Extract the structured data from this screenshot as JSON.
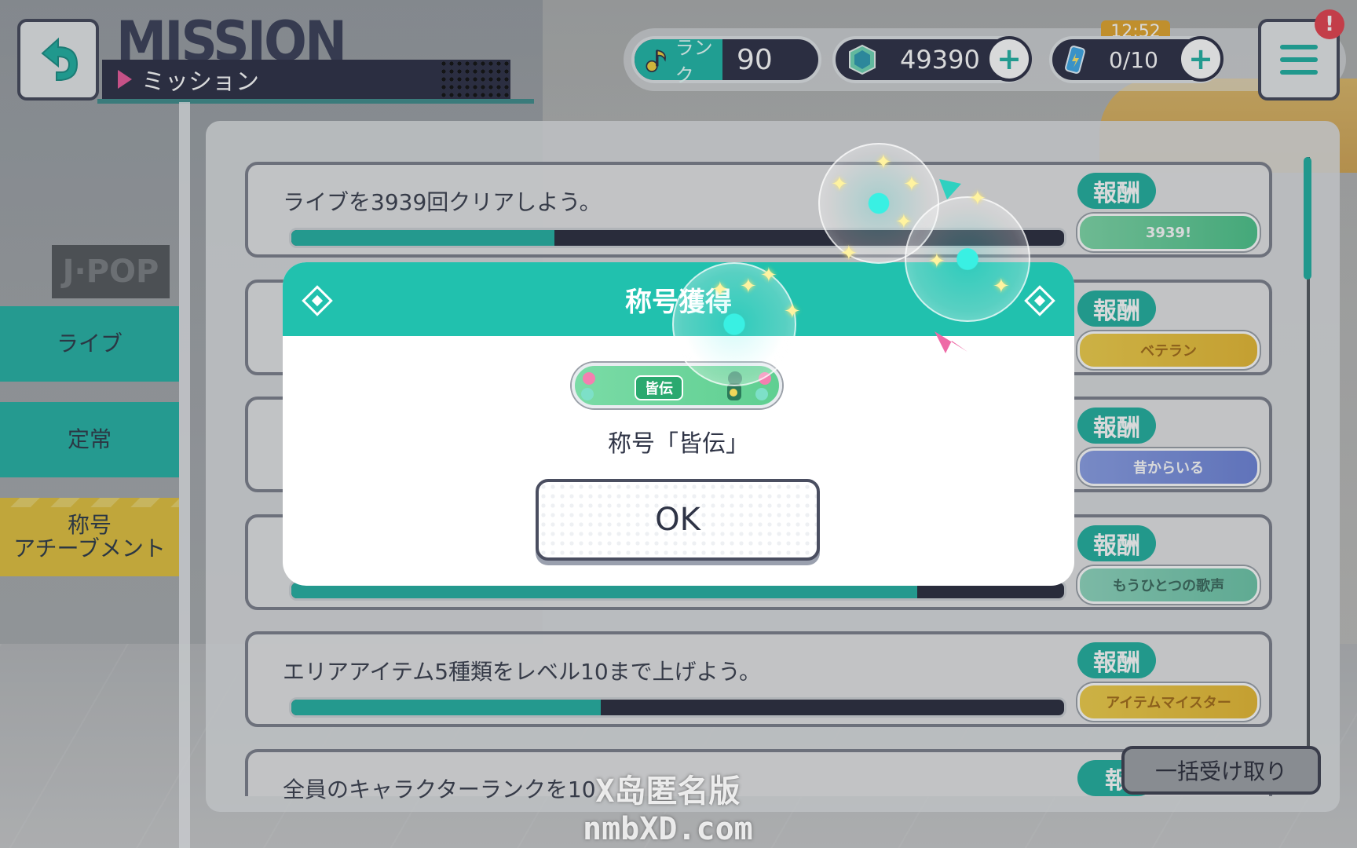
{
  "header": {
    "title": "MISSION",
    "subtitle": "ミッション",
    "rank_label": "ランク",
    "rank_value": "90",
    "gems": "49390",
    "stamina": "0/10",
    "timer": "12:52",
    "notification": "!"
  },
  "sidebar": {
    "tabs": [
      {
        "label": "ライブ"
      },
      {
        "label": "定常"
      },
      {
        "label_line1": "称号",
        "label_line2": "アチーブメント"
      }
    ]
  },
  "missions": [
    {
      "text": "ライブを3939回クリアしよう。",
      "progress": 0.34,
      "reward_label": "報酬",
      "reward_plate": "3939!"
    },
    {
      "text": "",
      "progress": 0.0,
      "reward_label": "報酬",
      "reward_plate": "ベテラン"
    },
    {
      "text": "",
      "progress": 0.0,
      "reward_label": "報酬",
      "reward_plate": "昔からいる"
    },
    {
      "text": "",
      "progress": 0.81,
      "reward_label": "報酬",
      "reward_plate": "もうひとつの歌声"
    },
    {
      "text": "エリアアイテム5種類をレベル10まで上げよう。",
      "progress": 0.4,
      "reward_label": "報酬",
      "reward_plate": "アイテムマイスター"
    },
    {
      "text": "全員のキャラクターランクを10",
      "progress": 0.0,
      "reward_label": "報",
      "reward_plate": ""
    }
  ],
  "bulk_button": "一括受け取り",
  "modal": {
    "title": "称号獲得",
    "plate_badge": "皆伝",
    "message": "称号「皆伝」",
    "ok_label": "OK"
  },
  "watermark": {
    "line1": "X岛匿名版",
    "line2": "nmbXD.com"
  },
  "colors": {
    "accent": "#21c1ae",
    "dark": "#2d2f45",
    "pink": "#ea5a9a",
    "yellow": "#e2c13d"
  }
}
